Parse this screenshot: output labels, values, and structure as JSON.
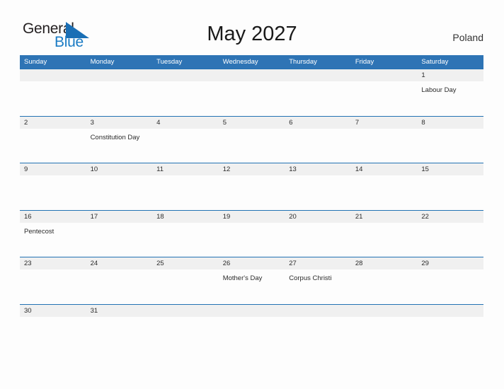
{
  "header": {
    "logo": {
      "text_primary": "General",
      "text_secondary": "Blue",
      "flag_icon": "blue-triangle-flag-icon",
      "primary_color": "#231f20",
      "secondary_color": "#1a7bc4"
    },
    "title": "May 2027",
    "region": "Poland"
  },
  "calendar": {
    "header_color": "#2e74b5",
    "row_divider_color": "#2272b4",
    "band_color": "#f0f0f0",
    "weekdays": [
      "Sunday",
      "Monday",
      "Tuesday",
      "Wednesday",
      "Thursday",
      "Friday",
      "Saturday"
    ],
    "weeks": [
      {
        "days": [
          {
            "number": "",
            "event": ""
          },
          {
            "number": "",
            "event": ""
          },
          {
            "number": "",
            "event": ""
          },
          {
            "number": "",
            "event": ""
          },
          {
            "number": "",
            "event": ""
          },
          {
            "number": "",
            "event": ""
          },
          {
            "number": "1",
            "event": "Labour Day"
          }
        ]
      },
      {
        "days": [
          {
            "number": "2",
            "event": ""
          },
          {
            "number": "3",
            "event": "Constitution Day"
          },
          {
            "number": "4",
            "event": ""
          },
          {
            "number": "5",
            "event": ""
          },
          {
            "number": "6",
            "event": ""
          },
          {
            "number": "7",
            "event": ""
          },
          {
            "number": "8",
            "event": ""
          }
        ]
      },
      {
        "days": [
          {
            "number": "9",
            "event": ""
          },
          {
            "number": "10",
            "event": ""
          },
          {
            "number": "11",
            "event": ""
          },
          {
            "number": "12",
            "event": ""
          },
          {
            "number": "13",
            "event": ""
          },
          {
            "number": "14",
            "event": ""
          },
          {
            "number": "15",
            "event": ""
          }
        ]
      },
      {
        "days": [
          {
            "number": "16",
            "event": "Pentecost"
          },
          {
            "number": "17",
            "event": ""
          },
          {
            "number": "18",
            "event": ""
          },
          {
            "number": "19",
            "event": ""
          },
          {
            "number": "20",
            "event": ""
          },
          {
            "number": "21",
            "event": ""
          },
          {
            "number": "22",
            "event": ""
          }
        ]
      },
      {
        "days": [
          {
            "number": "23",
            "event": ""
          },
          {
            "number": "24",
            "event": ""
          },
          {
            "number": "25",
            "event": ""
          },
          {
            "number": "26",
            "event": "Mother's Day"
          },
          {
            "number": "27",
            "event": "Corpus Christi"
          },
          {
            "number": "28",
            "event": ""
          },
          {
            "number": "29",
            "event": ""
          }
        ]
      },
      {
        "days": [
          {
            "number": "30",
            "event": ""
          },
          {
            "number": "31",
            "event": ""
          },
          {
            "number": "",
            "event": ""
          },
          {
            "number": "",
            "event": ""
          },
          {
            "number": "",
            "event": ""
          },
          {
            "number": "",
            "event": ""
          },
          {
            "number": "",
            "event": ""
          }
        ]
      }
    ]
  }
}
